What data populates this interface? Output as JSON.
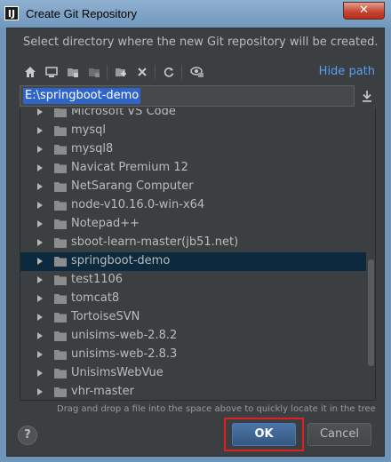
{
  "window": {
    "title": "Create Git Repository",
    "app_icon_letter": "IJ"
  },
  "description": "Select directory where the new Git repository will be created.",
  "toolbar": {
    "icons": [
      "home-icon",
      "desktop-icon",
      "project-icon",
      "module-icon",
      "new-folder-icon",
      "delete-icon",
      "refresh-icon",
      "show-hidden-icon"
    ],
    "hide_path": "Hide path"
  },
  "path": {
    "value": "E:\\springboot-demo"
  },
  "tree": {
    "items": [
      {
        "label": "Microsoft VS Code",
        "selected": false
      },
      {
        "label": "mysql",
        "selected": false
      },
      {
        "label": "mysql8",
        "selected": false
      },
      {
        "label": "Navicat Premium 12",
        "selected": false
      },
      {
        "label": "NetSarang Computer",
        "selected": false
      },
      {
        "label": "node-v10.16.0-win-x64",
        "selected": false
      },
      {
        "label": "Notepad++",
        "selected": false
      },
      {
        "label": "sboot-learn-master(jb51.net)",
        "selected": false
      },
      {
        "label": "springboot-demo",
        "selected": true
      },
      {
        "label": "test1106",
        "selected": false
      },
      {
        "label": "tomcat8",
        "selected": false
      },
      {
        "label": "TortoiseSVN",
        "selected": false
      },
      {
        "label": "unisims-web-2.8.2",
        "selected": false
      },
      {
        "label": "unisims-web-2.8.3",
        "selected": false
      },
      {
        "label": "UnisimsWebVue",
        "selected": false
      },
      {
        "label": "vhr-master",
        "selected": false
      }
    ]
  },
  "hint": "Drag and drop a file into the space above to quickly locate it in the tree",
  "buttons": {
    "help": "?",
    "ok": "OK",
    "cancel": "Cancel"
  },
  "colors": {
    "accent": "#589df6",
    "selection": "#0d293e",
    "highlight": "#e02020"
  }
}
